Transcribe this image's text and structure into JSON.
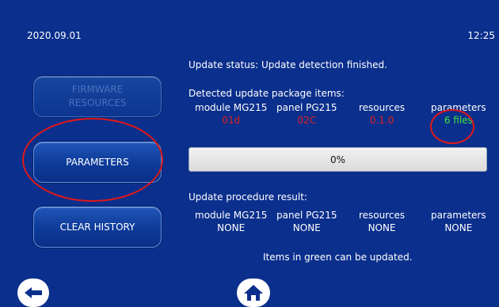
{
  "topbar": {
    "date": "2020.09.01",
    "time": "12:25"
  },
  "sidebar": {
    "firmware_line1": "FIRMWARE",
    "firmware_line2": "RESOURCES",
    "parameters": "PARAMETERS",
    "clear_history": "CLEAR HISTORY"
  },
  "status": {
    "text": "Update status: Update detection finished."
  },
  "detected": {
    "title": "Detected update package items:",
    "items": [
      {
        "label": "module MG215",
        "value": "01d",
        "color": "#e0201c"
      },
      {
        "label": "panel PG215",
        "value": "02C",
        "color": "#e0201c"
      },
      {
        "label": "resources",
        "value": "0.1.0",
        "color": "#e0201c"
      },
      {
        "label": "parameters",
        "value": "6 files",
        "color": "#3de63d"
      }
    ]
  },
  "progress": {
    "label": "0%",
    "value": 0
  },
  "result": {
    "title": "Update procedure result:",
    "items": [
      {
        "label": "module MG215",
        "value": "NONE"
      },
      {
        "label": "panel PG215",
        "value": "NONE"
      },
      {
        "label": "resources",
        "value": "NONE"
      },
      {
        "label": "parameters",
        "value": "NONE"
      }
    ]
  },
  "note": "Items in green can be updated.",
  "nav": {
    "back_icon": "arrow-left-icon",
    "home_icon": "home-icon"
  },
  "colors": {
    "background": "#0b2f8c",
    "highlight": "#e01818",
    "ok": "#3de63d",
    "not_ok": "#e0201c"
  }
}
